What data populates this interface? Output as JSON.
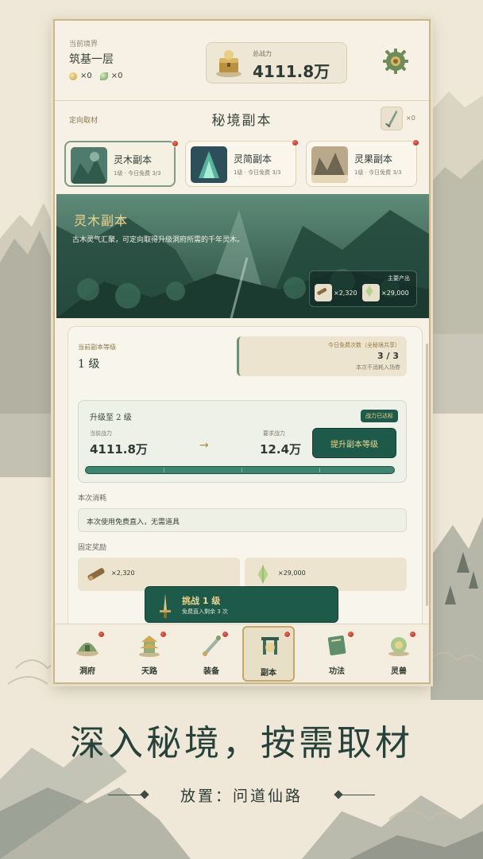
{
  "header": {
    "realm_caption": "当前境界",
    "realm_value": "筑基一层",
    "gold_count": "×0",
    "jade_count": "×0",
    "power_caption": "总战力",
    "power_value": "4111.8万"
  },
  "titlebar": {
    "directed_link": "定向取材",
    "page_title": "秘境副本",
    "ticket_count": "×0"
  },
  "tabs": [
    {
      "name": "灵木副本",
      "sub": "1级 · 今日免费 3/3",
      "active": true
    },
    {
      "name": "灵简副本",
      "sub": "1级 · 今日免费 3/3",
      "active": false
    },
    {
      "name": "灵果副本",
      "sub": "1级 · 今日免费 3/3",
      "active": false
    }
  ],
  "banner": {
    "title": "灵木副本",
    "desc": "古木灵气汇聚，可定向取得升级洞府所需的千年灵木。",
    "output_caption": "主要产出",
    "output_wood": "×2,320",
    "output_crystal": "×29,000"
  },
  "level": {
    "caption": "当前副本等级",
    "value": "1 级",
    "free_caption": "今日免费次数（全秘境共享）",
    "free_value": "3 / 3",
    "free_note": "本次不消耗入场券"
  },
  "upgrade": {
    "title": "升级至 2 级",
    "badge": "战力已达标",
    "current_caption": "当前战力",
    "current_value": "4111.8万",
    "required_caption": "要求战力",
    "required_value": "12.4万",
    "button": "提升副本等级",
    "progress": 1.0
  },
  "cost": {
    "caption": "本次消耗",
    "text": "本次使用免费直入，无需道具"
  },
  "rewards": {
    "caption": "固定奖励",
    "wood": "×2,320",
    "crystal": "×29,000"
  },
  "challenge": {
    "title": "挑战 1 级",
    "sub": "免费直入剩余 3 次"
  },
  "nav": [
    {
      "label": "洞府",
      "icon": "cave-icon"
    },
    {
      "label": "天路",
      "icon": "pagoda-icon"
    },
    {
      "label": "装备",
      "icon": "sword-icon"
    },
    {
      "label": "副本",
      "icon": "gate-icon"
    },
    {
      "label": "功法",
      "icon": "book-icon"
    },
    {
      "label": "灵兽",
      "icon": "beast-icon"
    }
  ],
  "slogan": "深入秘境，按需取材",
  "subtitle": "放置：问道仙路",
  "colors": {
    "primary_green": "#1d5a49",
    "gold_text": "#f1d58a",
    "paper": "#f6f1e4",
    "badge_red": "#c0392b"
  }
}
